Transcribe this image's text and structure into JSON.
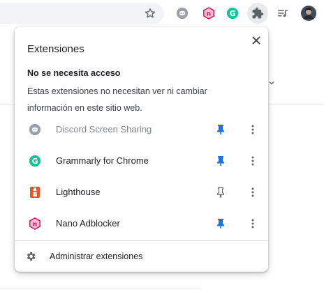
{
  "toolbar": {
    "icons": [
      "star-icon",
      "discord-extension-icon",
      "nano-adblocker-extension-icon",
      "grammarly-extension-icon",
      "puzzle-extensions-icon",
      "media-control-icon",
      "profile-avatar"
    ]
  },
  "popup": {
    "title": "Extensiones",
    "close_icon": "close-icon",
    "section_heading": "No se necesita acceso",
    "section_description": "Estas extensiones no necesitan ver ni cambiar información en este sitio web.",
    "extensions": [
      {
        "name": "Discord Screen Sharing",
        "icon": "discord-icon",
        "pinned": true,
        "dimmed": true
      },
      {
        "name": "Grammarly for Chrome",
        "icon": "grammarly-icon",
        "pinned": true,
        "dimmed": false
      },
      {
        "name": "Lighthouse",
        "icon": "lighthouse-icon",
        "pinned": false,
        "dimmed": false
      },
      {
        "name": "Nano Adblocker",
        "icon": "nano-adblocker-icon",
        "pinned": true,
        "dimmed": false
      }
    ],
    "manage_label": "Administrar extensiones"
  },
  "colors": {
    "pin_active": "#1a73e8",
    "pin_inactive": "#5f6368",
    "grammarly": "#15c39a",
    "nano": "#c2185b",
    "lighthouse": "#f4511e",
    "discord_dim": "#9aa0a6"
  }
}
